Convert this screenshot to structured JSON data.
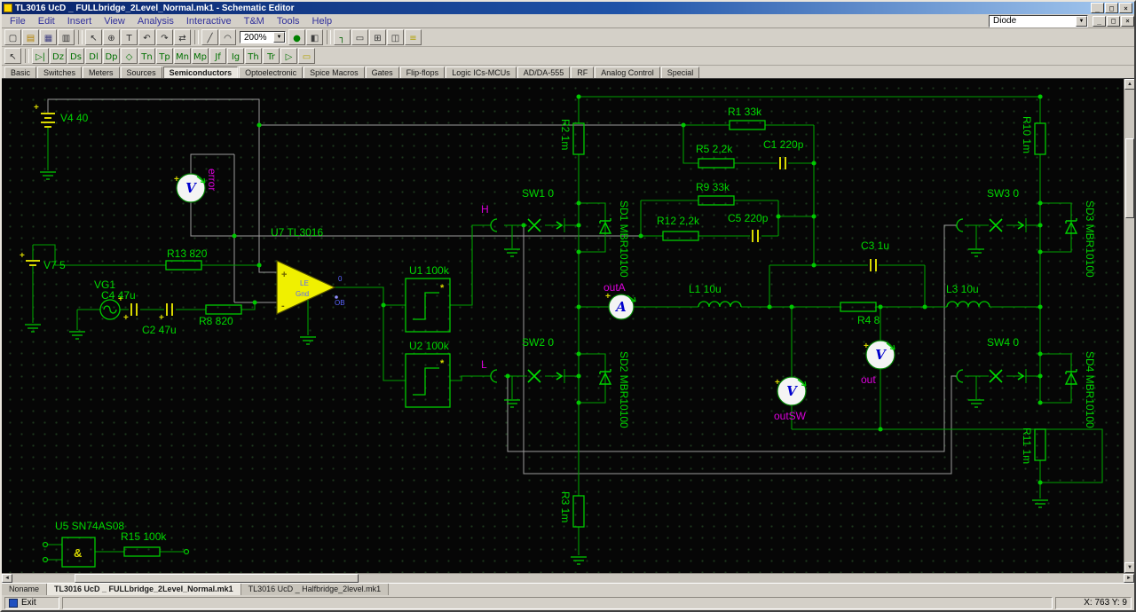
{
  "window": {
    "title": "TL3016 UcD _ FULLbridge_2Level_Normal.mk1 - Schematic Editor",
    "controls": {
      "minimize": "_",
      "maximize": "□",
      "close": "×"
    }
  },
  "menu": {
    "items": [
      "File",
      "Edit",
      "Insert",
      "View",
      "Analysis",
      "Interactive",
      "T&M",
      "Tools",
      "Help"
    ]
  },
  "toolbars": {
    "zoom_value": "200%",
    "component_select_value": "Diode",
    "row1a": [
      {
        "name": "new-file",
        "glyph": "▢"
      },
      {
        "name": "open-file",
        "glyph": "▤",
        "color": "#b08000"
      },
      {
        "name": "save-file",
        "glyph": "▦",
        "color": "#404080"
      },
      {
        "name": "print",
        "glyph": "▥"
      },
      {
        "name": "separator",
        "sep": true
      },
      {
        "name": "select-mode",
        "glyph": "↖"
      },
      {
        "name": "zoom-tool",
        "glyph": "⊕"
      },
      {
        "name": "text-tool",
        "glyph": "T"
      },
      {
        "name": "rotate-left",
        "glyph": "↶"
      },
      {
        "name": "rotate-right",
        "glyph": "↷"
      },
      {
        "name": "mirror-tool",
        "glyph": "⇄"
      },
      {
        "name": "separator",
        "sep": true
      },
      {
        "name": "draw-line",
        "glyph": "╱"
      },
      {
        "name": "draw-arc",
        "glyph": "◠"
      }
    ],
    "row1b": [
      {
        "name": "run-interactive",
        "glyph": "●",
        "color": "#008000"
      },
      {
        "name": "interactive-slider",
        "glyph": "◧",
        "color": "#404040"
      },
      {
        "name": "separator",
        "sep": true
      },
      {
        "name": "wire-tool",
        "glyph": "┐",
        "color": "#006000"
      },
      {
        "name": "macro-tool",
        "glyph": "▭"
      },
      {
        "name": "grid-toggle",
        "glyph": "⊞"
      },
      {
        "name": "io-tool",
        "glyph": "◫"
      },
      {
        "name": "list-tool",
        "glyph": "≡",
        "color": "#b0a000"
      }
    ],
    "row2": [
      {
        "name": "select-mode",
        "glyph": "↖"
      },
      {
        "name": "separator",
        "sep": true
      },
      {
        "name": "diode-component",
        "glyph": "▷|",
        "color": "#007000"
      },
      {
        "name": "zener-diode-component",
        "glyph": "Dz",
        "color": "#007000"
      },
      {
        "name": "schottky-diode-component",
        "glyph": "Ds",
        "color": "#007000"
      },
      {
        "name": "led-component",
        "glyph": "Dl",
        "color": "#007000"
      },
      {
        "name": "photodiode-component",
        "glyph": "Dp",
        "color": "#007000"
      },
      {
        "name": "bridge-rectifier-component",
        "glyph": "◇",
        "color": "#007000"
      },
      {
        "name": "npn-transistor-component",
        "glyph": "Tn",
        "color": "#007000"
      },
      {
        "name": "pnp-transistor-component",
        "glyph": "Tp",
        "color": "#007000"
      },
      {
        "name": "nmos-transistor-component",
        "glyph": "Mn",
        "color": "#007000"
      },
      {
        "name": "pmos-transistor-component",
        "glyph": "Mp",
        "color": "#007000"
      },
      {
        "name": "jfet-component",
        "glyph": "Jf",
        "color": "#007000"
      },
      {
        "name": "igbt-component",
        "glyph": "Ig",
        "color": "#007000"
      },
      {
        "name": "thyristor-component",
        "glyph": "Th",
        "color": "#007000"
      },
      {
        "name": "triac-component",
        "glyph": "Tr",
        "color": "#007000"
      },
      {
        "name": "opamp-component",
        "glyph": "▷",
        "color": "#007000"
      },
      {
        "name": "ic-component",
        "glyph": "▭",
        "color": "#b0a000"
      }
    ],
    "icons": {
      "dropdown": "▼",
      "up": "▲",
      "down": "▼",
      "left": "◄",
      "right": "►"
    }
  },
  "component_tabs": {
    "items": [
      "Basic",
      "Switches",
      "Meters",
      "Sources",
      "Semiconductors",
      "Optoelectronic",
      "Spice Macros",
      "Gates",
      "Flip-flops",
      "Logic ICs-MCUs",
      "AD/DA-555",
      "RF",
      "Analog Control",
      "Special"
    ],
    "active_index": 4
  },
  "sheet_tabs": {
    "items": [
      "Noname",
      "TL3016 UcD _ FULLbridge_2Level_Normal.mk1",
      "TL3016 UcD _ Halfbridge_2level.mk1"
    ],
    "active_index": 1
  },
  "status": {
    "exit_label": "Exit",
    "coords": "X: 763 Y: 9"
  },
  "schematic": {
    "labels": {
      "v4": "V4 40",
      "v7": "V7 5",
      "vg1": "VG1",
      "c4": "C4 47u",
      "c2": "C2 47u",
      "r13": "R13 820",
      "r8": "R8 820",
      "u7": "U7 TL3016",
      "u1": "U1 100k",
      "u2": "U2 100k",
      "u5": "U5 SN74AS08",
      "r15": "R15 100k",
      "r2": "R2 1m",
      "r3": "R3 1m",
      "r10": "R10 1m",
      "r11": "R11 1m",
      "sw1": "SW1 0",
      "sw2": "SW2 0",
      "sw3": "SW3 0",
      "sw4": "SW4 0",
      "sd1": "SD1 MBR10100",
      "sd2": "SD2 MBR10100",
      "sd3": "SD3 MBR10100",
      "sd4": "SD4 MBR10100",
      "r1": "R1 33k",
      "r5": "R5 2,2k",
      "c1": "C1 220p",
      "r9": "R9 33k",
      "r12": "R12 2,2k",
      "c5": "C5 220p",
      "c3": "C3 1u",
      "l1": "L1 10u",
      "l3": "L3 10u",
      "r4": "R4 8"
    },
    "nodes": {
      "error": "error",
      "h": "H",
      "l": "L",
      "outa": "outA",
      "out": "out",
      "outsw": "outSW"
    },
    "meters": {
      "error": "V",
      "outa": "A",
      "out": "V",
      "outsw": "V"
    },
    "pins": {
      "plus": "+",
      "minus": "-",
      "le": "LE",
      "gnd": "Gnd",
      "zero": "0",
      "ob": "OB",
      "star": "*",
      "and_gate": "&"
    },
    "colors": {
      "wire": "#00a000",
      "component": "#00cc00",
      "label": "#00d800",
      "node_label": "#dc00dc",
      "highlight_wire": "#9c9c9c",
      "accent": "#d8d800",
      "meter_letter": "#0000cc"
    }
  }
}
